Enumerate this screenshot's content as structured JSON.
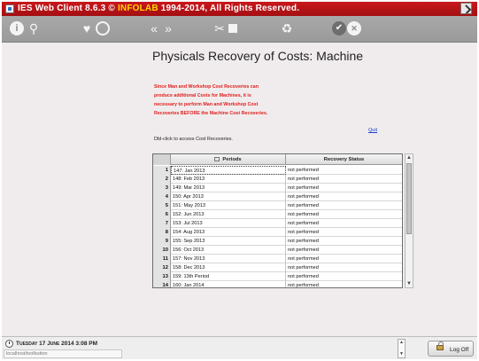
{
  "window": {
    "title_prefix": "IES Web Client 8.6.3 © ",
    "title_brand": "INFOLAB",
    "title_suffix": " 1994-2014, All Rights Reserved."
  },
  "toolbar": {
    "info": "i",
    "search": "⚲",
    "favorite": "♥",
    "back": "«",
    "forward": "»",
    "tools": "✂",
    "recycle": "♻",
    "confirm": "✔",
    "cancel": "✕"
  },
  "page": {
    "title": "Physicals Recovery of Costs: Machine",
    "warning_lines": [
      "Since Man and Workshop Cost Recoveries can",
      "produce additional Costs for Machines, it is",
      "necessary to perform Man and Workshop Cost",
      "Recoveries BEFORE the Machine Cost Recoveries."
    ],
    "quit_label": "Quit",
    "hint": "Dbl-click to access Cost Recoveries."
  },
  "grid": {
    "columns": [
      "Periods",
      "Recovery Status"
    ],
    "rows": [
      {
        "num": "1",
        "period": "147: Jan 2013",
        "status": "not performed"
      },
      {
        "num": "2",
        "period": "148: Feb 2013",
        "status": "not performed"
      },
      {
        "num": "3",
        "period": "149: Mar 2013",
        "status": "not performed"
      },
      {
        "num": "4",
        "period": "150: Apr 2013",
        "status": "not performed"
      },
      {
        "num": "5",
        "period": "151: May 2013",
        "status": "not performed"
      },
      {
        "num": "6",
        "period": "152: Jun 2013",
        "status": "not performed"
      },
      {
        "num": "7",
        "period": "153: Jul 2013",
        "status": "not performed"
      },
      {
        "num": "8",
        "period": "154: Aug 2013",
        "status": "not performed"
      },
      {
        "num": "9",
        "period": "155: Sep 2013",
        "status": "not performed"
      },
      {
        "num": "10",
        "period": "156: Oct 2013",
        "status": "not performed"
      },
      {
        "num": "11",
        "period": "157: Nov 2013",
        "status": "not performed"
      },
      {
        "num": "12",
        "period": "158: Dec 2013",
        "status": "not performed"
      },
      {
        "num": "13",
        "period": "159: 13th Period",
        "status": "not performed"
      },
      {
        "num": "14",
        "period": "160: Jan 2014",
        "status": "not performed"
      }
    ]
  },
  "status_bar": {
    "datetime": "Tuesday 17 June 2014 3:08 PM",
    "url": "localhost/toolbutton",
    "logoff_label": "Log Off"
  }
}
